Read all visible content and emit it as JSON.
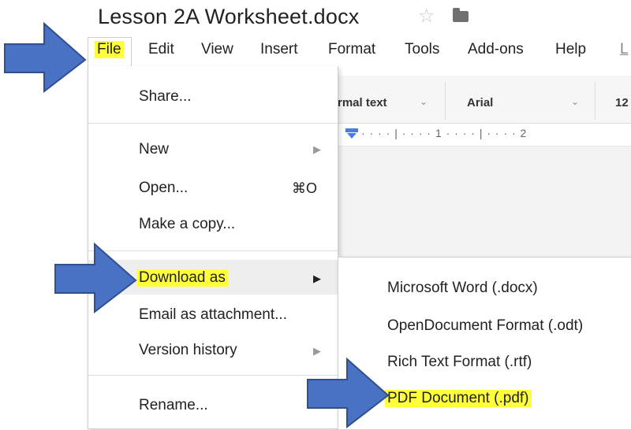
{
  "document": {
    "title": "Lesson 2A Worksheet.docx"
  },
  "menubar": {
    "items": [
      "File",
      "Edit",
      "View",
      "Insert",
      "Format",
      "Tools",
      "Add-ons",
      "Help",
      "L"
    ]
  },
  "toolbar": {
    "style": "rmal text",
    "font": "Arial",
    "size": "12"
  },
  "ruler": {
    "text": "· · · · | · · · · 1 · · · · | · · · · 2"
  },
  "file_menu": {
    "share": "Share...",
    "new": "New",
    "open": "Open...",
    "open_shortcut": "⌘O",
    "make_copy": "Make a copy...",
    "download_as": "Download as",
    "email_attachment": "Email as attachment...",
    "version_history": "Version history",
    "rename": "Rename..."
  },
  "download_submenu": {
    "items": [
      "Microsoft Word (.docx)",
      "OpenDocument Format (.odt)",
      "Rich Text Format (.rtf)",
      "PDF Document (.pdf)"
    ]
  },
  "colors": {
    "highlight": "#ffff3a",
    "arrow_fill": "#4a72c4",
    "arrow_stroke": "#2f4f8f"
  }
}
